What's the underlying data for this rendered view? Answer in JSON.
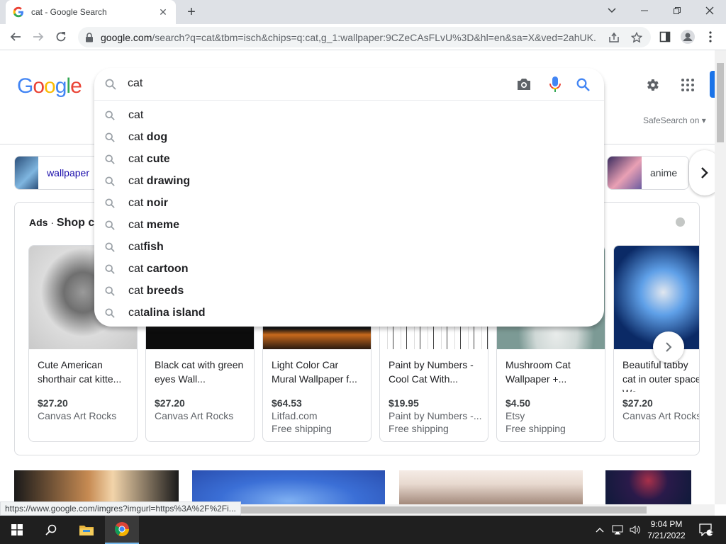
{
  "browser": {
    "tab_title": "cat - Google Search",
    "url_host": "google.com",
    "url_rest": "/search?q=cat&tbm=isch&chips=q:cat,g_1:wallpaper:9CZeCAsFLvU%3D&hl=en&sa=X&ved=2ahUK..."
  },
  "search": {
    "query": "cat",
    "safesearch": "SafeSearch on"
  },
  "logo": [
    "G",
    "o",
    "o",
    "g",
    "l",
    "e"
  ],
  "logo_colors": [
    "#4285F4",
    "#EA4335",
    "#FBBC05",
    "#4285F4",
    "#34A853",
    "#EA4335"
  ],
  "suggestions": [
    {
      "prefix": "cat",
      "bold": ""
    },
    {
      "prefix": "cat ",
      "bold": "dog"
    },
    {
      "prefix": "cat ",
      "bold": "cute"
    },
    {
      "prefix": "cat ",
      "bold": "drawing"
    },
    {
      "prefix": "cat ",
      "bold": "noir"
    },
    {
      "prefix": "cat ",
      "bold": "meme"
    },
    {
      "prefix": "cat",
      "bold": "fish"
    },
    {
      "prefix": "cat ",
      "bold": "cartoon"
    },
    {
      "prefix": "cat ",
      "bold": "breeds"
    },
    {
      "prefix": "cat",
      "bold": "alina island"
    }
  ],
  "chips": [
    {
      "label": "wallpaper",
      "icon": "thumbnail",
      "colors": [
        "#2b4f7a",
        "#7fb6e0"
      ]
    },
    {
      "label": "anime",
      "icon": "thumbnail",
      "colors": [
        "#3a2c5f",
        "#e9a0b4"
      ]
    }
  ],
  "ads": {
    "label": "Ads",
    "separator": "·",
    "heading": "Shop c",
    "products": [
      {
        "name": "Cute American shorthair cat kitte...",
        "price": "$27.20",
        "store": "Canvas Art Rocks",
        "shipping": "",
        "colors": [
          "#c9c9c9",
          "#6f6f6f"
        ]
      },
      {
        "name": "Black cat with green eyes Wall...",
        "price": "$27.20",
        "store": "Canvas Art Rocks",
        "shipping": "",
        "colors": [
          "#0a0a0a",
          "#1e1e1e"
        ]
      },
      {
        "name": "Light Color Car Mural Wallpaper f...",
        "price": "$64.53",
        "store": "Litfad.com",
        "shipping": "Free shipping",
        "colors": [
          "#111111",
          "#c8691c"
        ]
      },
      {
        "name": "Paint by Numbers - Cool Cat With...",
        "price": "$19.95",
        "store": "Paint by Numbers -...",
        "shipping": "Free shipping",
        "colors": [
          "#ffffff",
          "#444444"
        ]
      },
      {
        "name": "Mushroom Cat Wallpaper +...",
        "price": "$4.50",
        "store": "Etsy",
        "shipping": "Free shipping",
        "colors": [
          "#7c9a95",
          "#cfd8d6"
        ]
      },
      {
        "name": "Beautiful tabby cat in outer space Wa...",
        "price": "$27.20",
        "store": "Canvas Art Rocks",
        "shipping": "",
        "colors": [
          "#0b2a66",
          "#5fa0e8"
        ]
      }
    ]
  },
  "results": [
    {
      "colors": [
        "#1a1a1a",
        "#c68a52"
      ]
    },
    {
      "colors": [
        "#3b6fd6",
        "#7fb0f2"
      ]
    },
    {
      "colors": [
        "#e8d9cf",
        "#a38a7c"
      ]
    },
    {
      "colors": [
        "#0f1a3a",
        "#a8304a"
      ]
    }
  ],
  "status": {
    "url": "https://www.google.com/imgres?imgurl=https%3A%2F%2Fi..."
  },
  "taskbar": {
    "time": "9:04 PM",
    "date": "7/21/2022",
    "notification_count": "1"
  }
}
